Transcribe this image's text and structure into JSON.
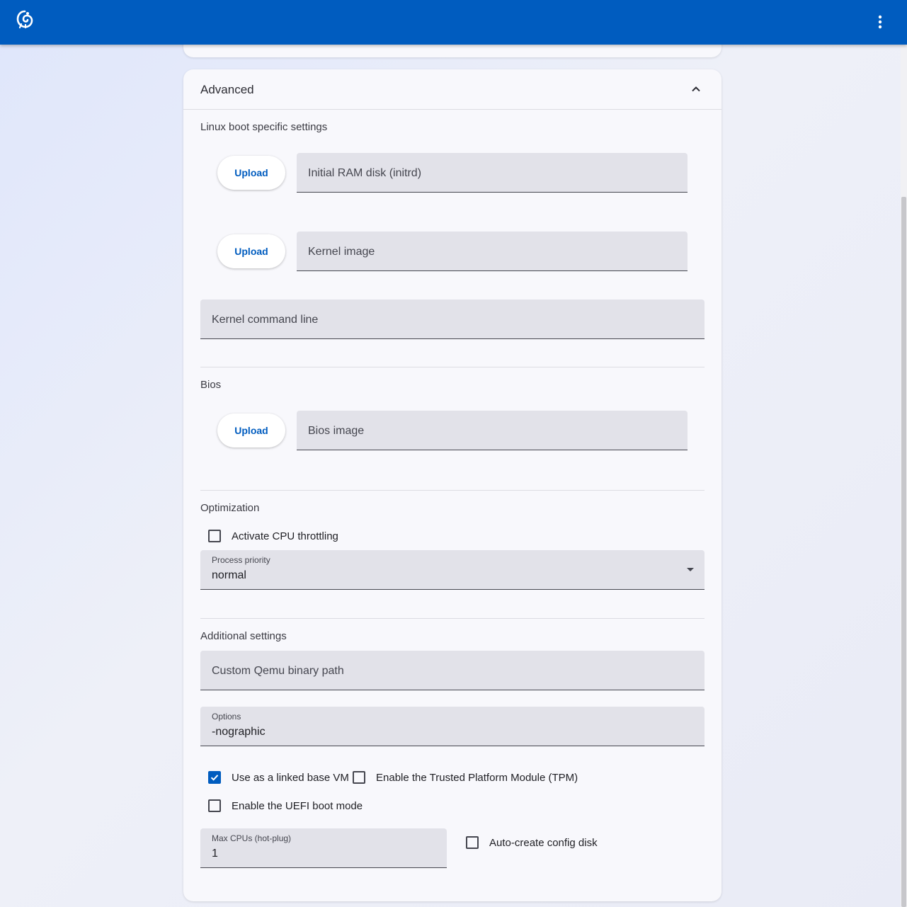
{
  "colors": {
    "brand": "#005cbf",
    "card_background": "#f8f8fc",
    "field_background": "#e2e2e9"
  },
  "topbar": {
    "logo_icon": "chameleon-logo",
    "menu_icon": "more-vertical-icon"
  },
  "advanced": {
    "title": "Advanced",
    "collapse_icon": "chevron-up-icon",
    "linux_boot": {
      "title": "Linux boot specific settings",
      "initrd": {
        "button": "Upload",
        "label": "Initial RAM disk (initrd)"
      },
      "kernel": {
        "button": "Upload",
        "label": "Kernel image"
      },
      "cmdline": {
        "label": "Kernel command line"
      }
    },
    "bios": {
      "title": "Bios",
      "image": {
        "button": "Upload",
        "label": "Bios image"
      }
    },
    "optimization": {
      "title": "Optimization",
      "cpu_throttling": {
        "label": "Activate CPU throttling",
        "checked": false
      },
      "process_priority": {
        "label": "Process priority",
        "value": "normal"
      }
    },
    "additional": {
      "title": "Additional settings",
      "qemu_path": {
        "label": "Custom Qemu binary path"
      },
      "options": {
        "label": "Options",
        "value": "-nographic"
      },
      "linked_base": {
        "label": "Use as a linked base VM",
        "checked": true
      },
      "tpm": {
        "label": "Enable the Trusted Platform Module (TPM)",
        "checked": false
      },
      "uefi": {
        "label": "Enable the UEFI boot mode",
        "checked": false
      },
      "max_cpus": {
        "label": "Max CPUs (hot-plug)",
        "value": "1"
      },
      "config_disk": {
        "label": "Auto-create config disk",
        "checked": false
      }
    }
  }
}
